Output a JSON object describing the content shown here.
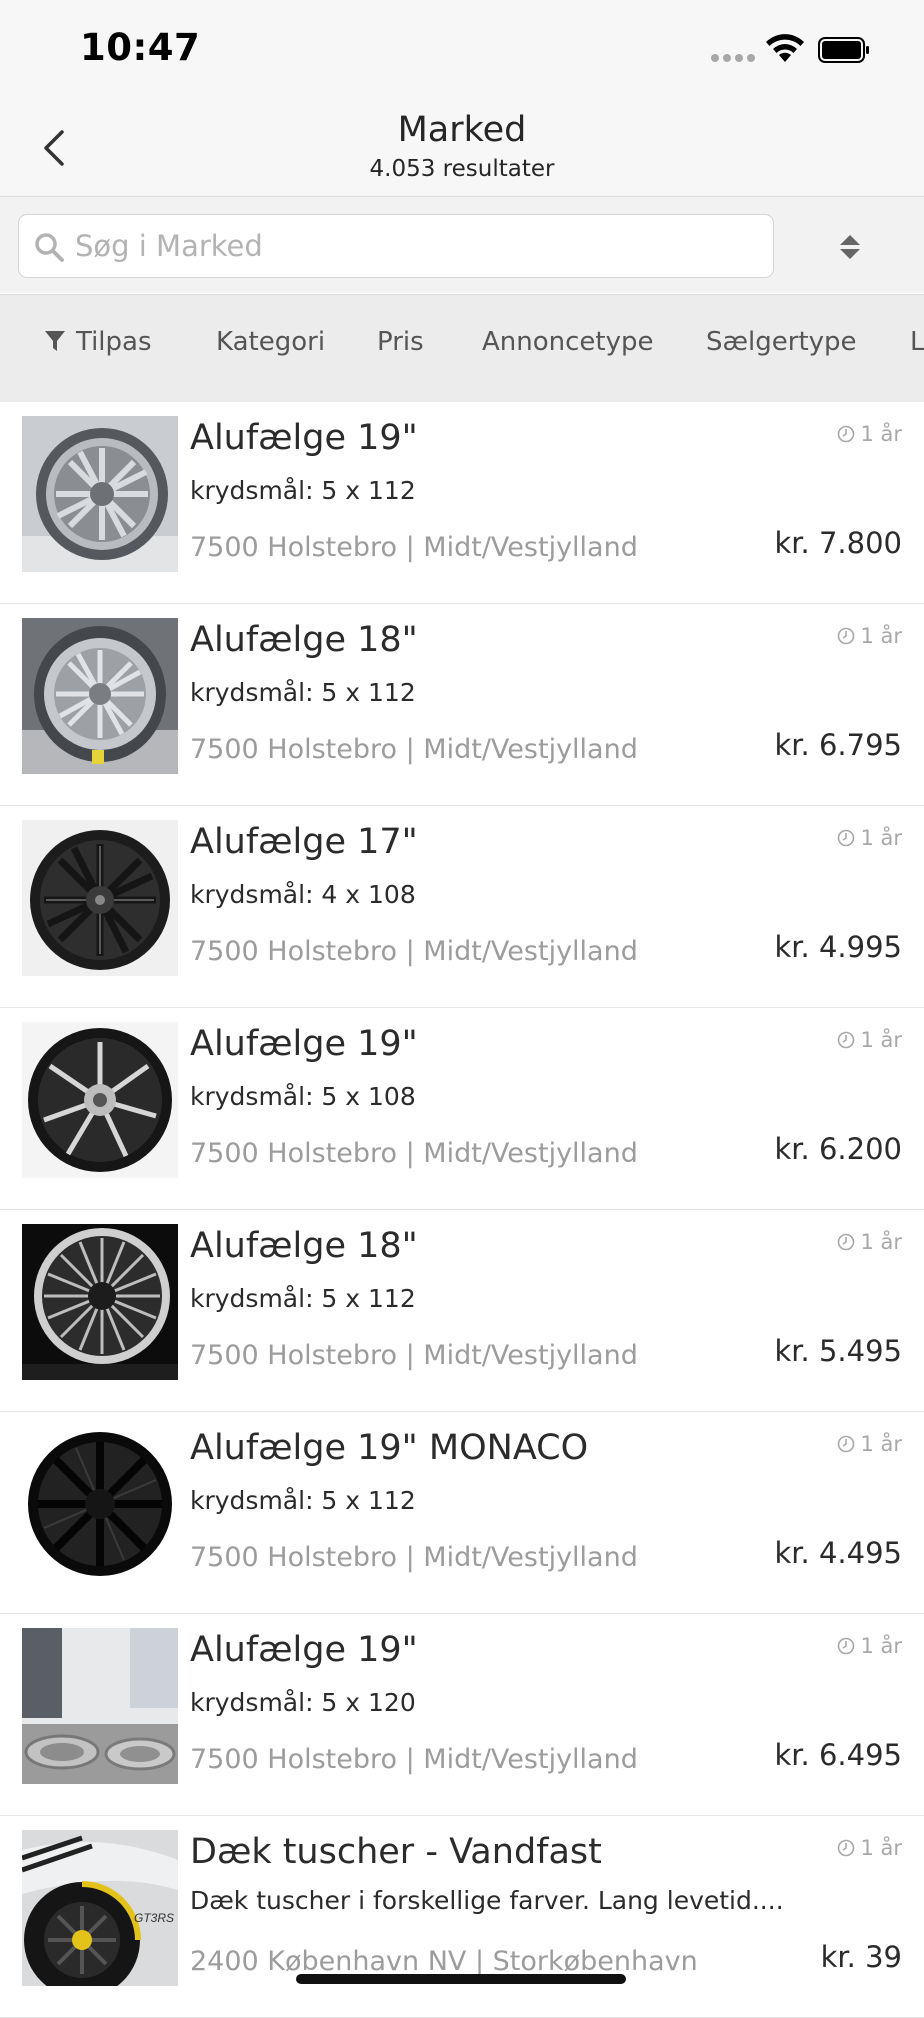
{
  "status_bar": {
    "time": "10:47"
  },
  "nav": {
    "title": "Marked",
    "subtitle": "4.053 resultater"
  },
  "search": {
    "placeholder": "Søg i Marked"
  },
  "filters": [
    "Tilpas",
    "Kategori",
    "Pris",
    "Annoncetype",
    "Sælgertype",
    "L"
  ],
  "listings": [
    {
      "title": "Alufælge 19\"",
      "detail": "krydsmål: 5 x 112",
      "location": "7500 Holstebro | Midt/Vestjylland",
      "age": "1 år",
      "price": "kr. 7.800"
    },
    {
      "title": "Alufælge 18\"",
      "detail": "krydsmål: 5 x 112",
      "location": "7500 Holstebro | Midt/Vestjylland",
      "age": "1 år",
      "price": "kr. 6.795"
    },
    {
      "title": "Alufælge 17\"",
      "detail": "krydsmål: 4 x 108",
      "location": "7500 Holstebro | Midt/Vestjylland",
      "age": "1 år",
      "price": "kr. 4.995"
    },
    {
      "title": "Alufælge 19\"",
      "detail": "krydsmål: 5 x 108",
      "location": "7500 Holstebro | Midt/Vestjylland",
      "age": "1 år",
      "price": "kr. 6.200"
    },
    {
      "title": "Alufælge 18\"",
      "detail": "krydsmål: 5 x 112",
      "location": "7500 Holstebro | Midt/Vestjylland",
      "age": "1 år",
      "price": "kr. 5.495"
    },
    {
      "title": "Alufælge 19\" MONACO",
      "detail": "krydsmål: 5 x 112",
      "location": "7500 Holstebro | Midt/Vestjylland",
      "age": "1 år",
      "price": "kr. 4.495"
    },
    {
      "title": "Alufælge 19\"",
      "detail": "krydsmål: 5 x 120",
      "location": "7500 Holstebro | Midt/Vestjylland",
      "age": "1 år",
      "price": "kr. 6.495"
    },
    {
      "title": "Dæk tuscher - Vandfast",
      "detail": "Dæk tuscher i forskellige farver. Lang levetid....",
      "location": "2400 København NV | Storkøbenhavn",
      "age": "1 år",
      "price": "kr. 39"
    }
  ],
  "icons": [
    "back-chevron-icon",
    "search-icon",
    "sort-icon",
    "filter-icon",
    "clock-icon",
    "wifi-icon",
    "battery-icon",
    "signal-icon"
  ]
}
